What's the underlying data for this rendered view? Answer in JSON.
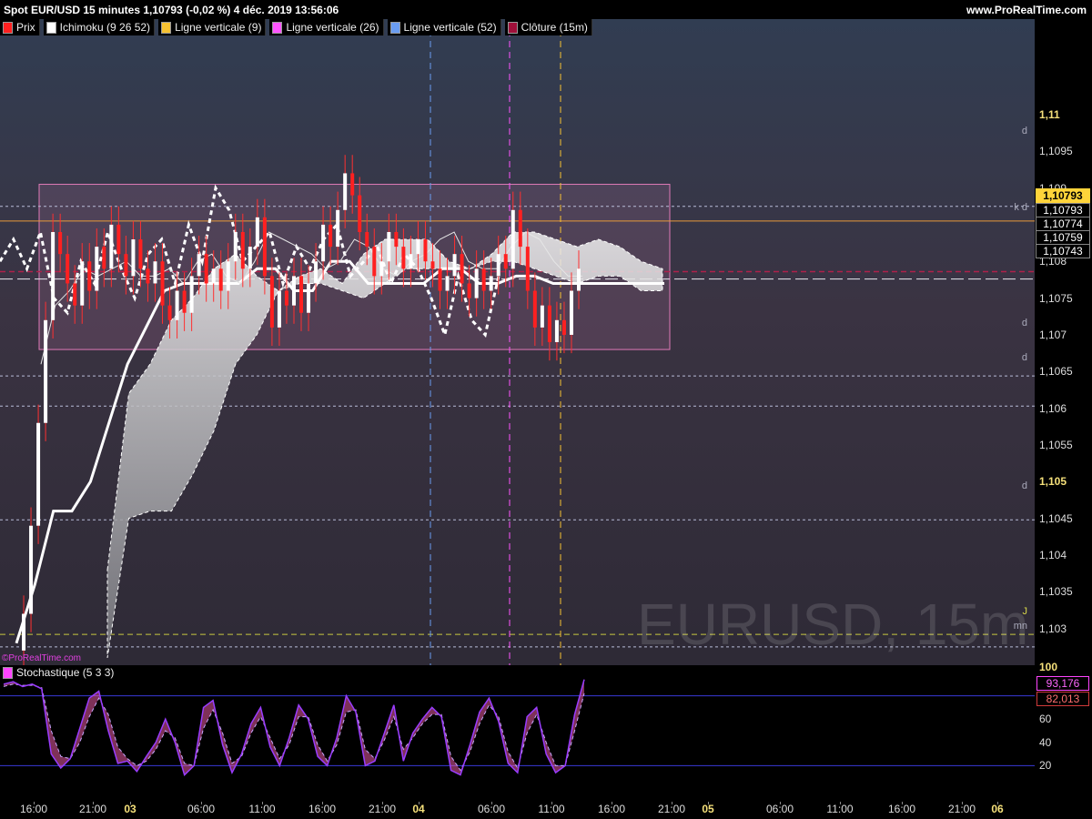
{
  "header": {
    "title": "Spot EUR/USD 15 minutes 1,10793 (-0,02 %) 4 déc. 2019 13:56:06",
    "site": "www.ProRealTime.com"
  },
  "legend": [
    {
      "label": "Prix",
      "color": "#ff2020"
    },
    {
      "label": "Ichimoku (9 26 52)",
      "color": "#ffffff"
    },
    {
      "label": "Ligne verticale (9)",
      "color": "#f7c232"
    },
    {
      "label": "Ligne verticale (26)",
      "color": "#ff55ff"
    },
    {
      "label": "Ligne verticale (52)",
      "color": "#6a9cf0"
    },
    {
      "label": "Clôture (15m)",
      "color": "#a0103a"
    }
  ],
  "watermark": "EURUSD, 15m",
  "credit": "©ProRealTime.com",
  "price_tags": [
    "1,10793",
    "1,10774",
    "1,10759",
    "1,10743"
  ],
  "level_tags": {
    "d": "d",
    "kd": "k d",
    "j": "J",
    "mn": "mn"
  },
  "stochastic": {
    "label": "Stochastique (5 3 3)",
    "k": "93,176",
    "d": "82,013",
    "top_label": "100"
  },
  "chart_data": [
    {
      "type": "line",
      "title": "Spot EUR/USD 15 minutes",
      "ylim": [
        1.1025,
        1.1113
      ],
      "yticks": [
        "1,11",
        "1,1095",
        "1,109",
        "1,1085",
        "1,108",
        "1,1075",
        "1,107",
        "1,1065",
        "1,106",
        "1,1055",
        "1,105",
        "1,1045",
        "1,104",
        "1,1035",
        "1,103"
      ],
      "bold_yticks": [
        "1,11",
        "1,105"
      ],
      "x_labels": [
        "16:00",
        "21:00",
        "03",
        "06:00",
        "11:00",
        "16:00",
        "21:00",
        "04",
        "06:00",
        "11:00",
        "16:00",
        "21:00",
        "05",
        "06:00",
        "11:00",
        "16:00",
        "21:00",
        "06"
      ],
      "bold_x_labels": [
        "03",
        "04",
        "05",
        "06"
      ],
      "last_price": 1.10793,
      "price_path": [
        1.1027,
        1.1032,
        1.1044,
        1.1058,
        1.1072,
        1.1084,
        1.1081,
        1.1077,
        1.1074,
        1.108,
        1.1076,
        1.1082,
        1.1079,
        1.1085,
        1.1081,
        1.1078,
        1.1083,
        1.1079,
        1.1077,
        1.108,
        1.1074,
        1.1072,
        1.1076,
        1.1073,
        1.1078,
        1.1081,
        1.1077,
        1.1079,
        1.1076,
        1.108,
        1.1084,
        1.1079,
        1.1082,
        1.1086,
        1.1078,
        1.1071,
        1.1076,
        1.1074,
        1.1078,
        1.1073,
        1.1077,
        1.108,
        1.1085,
        1.1082,
        1.1087,
        1.1092,
        1.1089,
        1.1084,
        1.1082,
        1.1078,
        1.108,
        1.1084,
        1.1082,
        1.1079,
        1.1081,
        1.1083,
        1.108,
        1.1079,
        1.1076,
        1.1078,
        1.1081,
        1.1077,
        1.1075,
        1.1079,
        1.1076,
        1.1078,
        1.1081,
        1.1079,
        1.1087,
        1.1082,
        1.1076,
        1.1071,
        1.1074,
        1.1069,
        1.1072,
        1.107,
        1.1076,
        1.1079
      ],
      "kijun_path": [
        1.1028,
        1.1036,
        1.1046,
        1.1046,
        1.105,
        1.1058,
        1.1066,
        1.1071,
        1.1076,
        1.1077,
        1.1077,
        1.1077,
        1.1077,
        1.1079,
        1.1079,
        1.1076,
        1.1076,
        1.108,
        1.108,
        1.1077,
        1.1077,
        1.1077,
        1.1077,
        1.1079,
        1.1079,
        1.1077,
        1.1077,
        1.1078,
        1.1078,
        1.1077,
        1.1077,
        1.1077,
        1.1077,
        1.1077,
        1.1077,
        1.1077
      ],
      "tenkan_path": [
        1.1066,
        1.1074,
        1.1076,
        1.1079,
        1.1078,
        1.1079,
        1.108,
        1.1078,
        1.1078,
        1.1079,
        1.1077,
        1.108,
        1.1081,
        1.1078,
        1.1077,
        1.108,
        1.1084,
        1.1083,
        1.1082,
        1.1081,
        1.1079,
        1.108,
        1.1083,
        1.1082,
        1.1079,
        1.1078,
        1.108,
        1.1081,
        1.1083,
        1.1084,
        1.108,
        1.1079,
        1.1079,
        1.1082,
        1.1084,
        1.1083,
        1.108,
        1.1078,
        1.1078
      ],
      "chikou_path": [
        1.108,
        1.1083,
        1.1079,
        1.1084,
        1.1075,
        1.1073,
        1.108,
        1.1077,
        1.1084,
        1.1079,
        1.1075,
        1.1081,
        1.1083,
        1.1077,
        1.1085,
        1.108,
        1.109,
        1.1087,
        1.108,
        1.1082,
        1.1084,
        1.1077,
        1.1082,
        1.1079,
        1.1083,
        1.1085,
        1.1078,
        1.108,
        1.1082,
        1.1077,
        1.1081,
        1.1079,
        1.1075,
        1.107,
        1.1078,
        1.1072,
        1.107,
        1.1078
      ],
      "cloud_top": [
        1.1038,
        1.1062,
        1.1066,
        1.1072,
        1.1075,
        1.1079,
        1.1081,
        1.1078,
        1.1076,
        1.1078,
        1.1079,
        1.1077,
        1.1081,
        1.1083,
        1.1083,
        1.1083,
        1.108,
        1.1079,
        1.1081,
        1.1084,
        1.1084,
        1.1083,
        1.1082,
        1.1083,
        1.1082,
        1.108,
        1.1079
      ],
      "cloud_bottom": [
        1.1026,
        1.1045,
        1.1046,
        1.1046,
        1.1051,
        1.1057,
        1.1066,
        1.107,
        1.1076,
        1.1077,
        1.1077,
        1.1076,
        1.1075,
        1.1077,
        1.1079,
        1.1079,
        1.1079,
        1.1079,
        1.108,
        1.108,
        1.1079,
        1.1078,
        1.1077,
        1.1078,
        1.1078,
        1.1076,
        1.1076
      ],
      "range_box": {
        "low": 1.1068,
        "high": 1.10905
      },
      "horizontal_levels": {
        "orange": 1.10855,
        "close_15m": 1.10786,
        "dashed_long": 1.10776,
        "dotted": [
          1.10875,
          1.10644,
          1.10603,
          1.10448,
          1.10275
        ],
        "yellow_dashed": 1.10292
      },
      "vertical_lines": [
        {
          "label": "Ligne verticale (52)",
          "color": "#6a9cf0",
          "x_label": "04"
        },
        {
          "label": "Ligne verticale (26)",
          "color": "#ff55ff",
          "x_label": "06:00"
        },
        {
          "label": "Ligne verticale (9)",
          "color": "#f7c232",
          "x_label": "11:00"
        }
      ]
    },
    {
      "type": "line",
      "title": "Stochastique (5 3 3)",
      "ylim": [
        0,
        100
      ],
      "yticks": [
        "60",
        "40",
        "20"
      ],
      "reference_levels": [
        80,
        20
      ],
      "k_last": 93.176,
      "d_last": 82.013,
      "k_path": [
        90,
        92,
        88,
        90,
        86,
        30,
        18,
        26,
        52,
        78,
        84,
        50,
        22,
        24,
        15,
        28,
        40,
        60,
        40,
        12,
        20,
        70,
        76,
        38,
        14,
        30,
        56,
        70,
        36,
        20,
        44,
        72,
        60,
        28,
        20,
        44,
        80,
        66,
        20,
        24,
        48,
        72,
        24,
        48,
        60,
        70,
        62,
        16,
        12,
        38,
        66,
        78,
        58,
        22,
        14,
        62,
        70,
        30,
        14,
        20,
        64,
        94
      ],
      "d_path": [
        88,
        90,
        89,
        89,
        87,
        50,
        28,
        26,
        40,
        62,
        78,
        64,
        36,
        26,
        20,
        24,
        34,
        50,
        44,
        22,
        20,
        52,
        68,
        48,
        22,
        28,
        48,
        62,
        44,
        26,
        38,
        62,
        62,
        38,
        24,
        38,
        66,
        68,
        34,
        26,
        42,
        62,
        34,
        44,
        56,
        64,
        64,
        28,
        16,
        32,
        56,
        72,
        62,
        32,
        18,
        48,
        64,
        40,
        20,
        20,
        50,
        82
      ]
    }
  ]
}
